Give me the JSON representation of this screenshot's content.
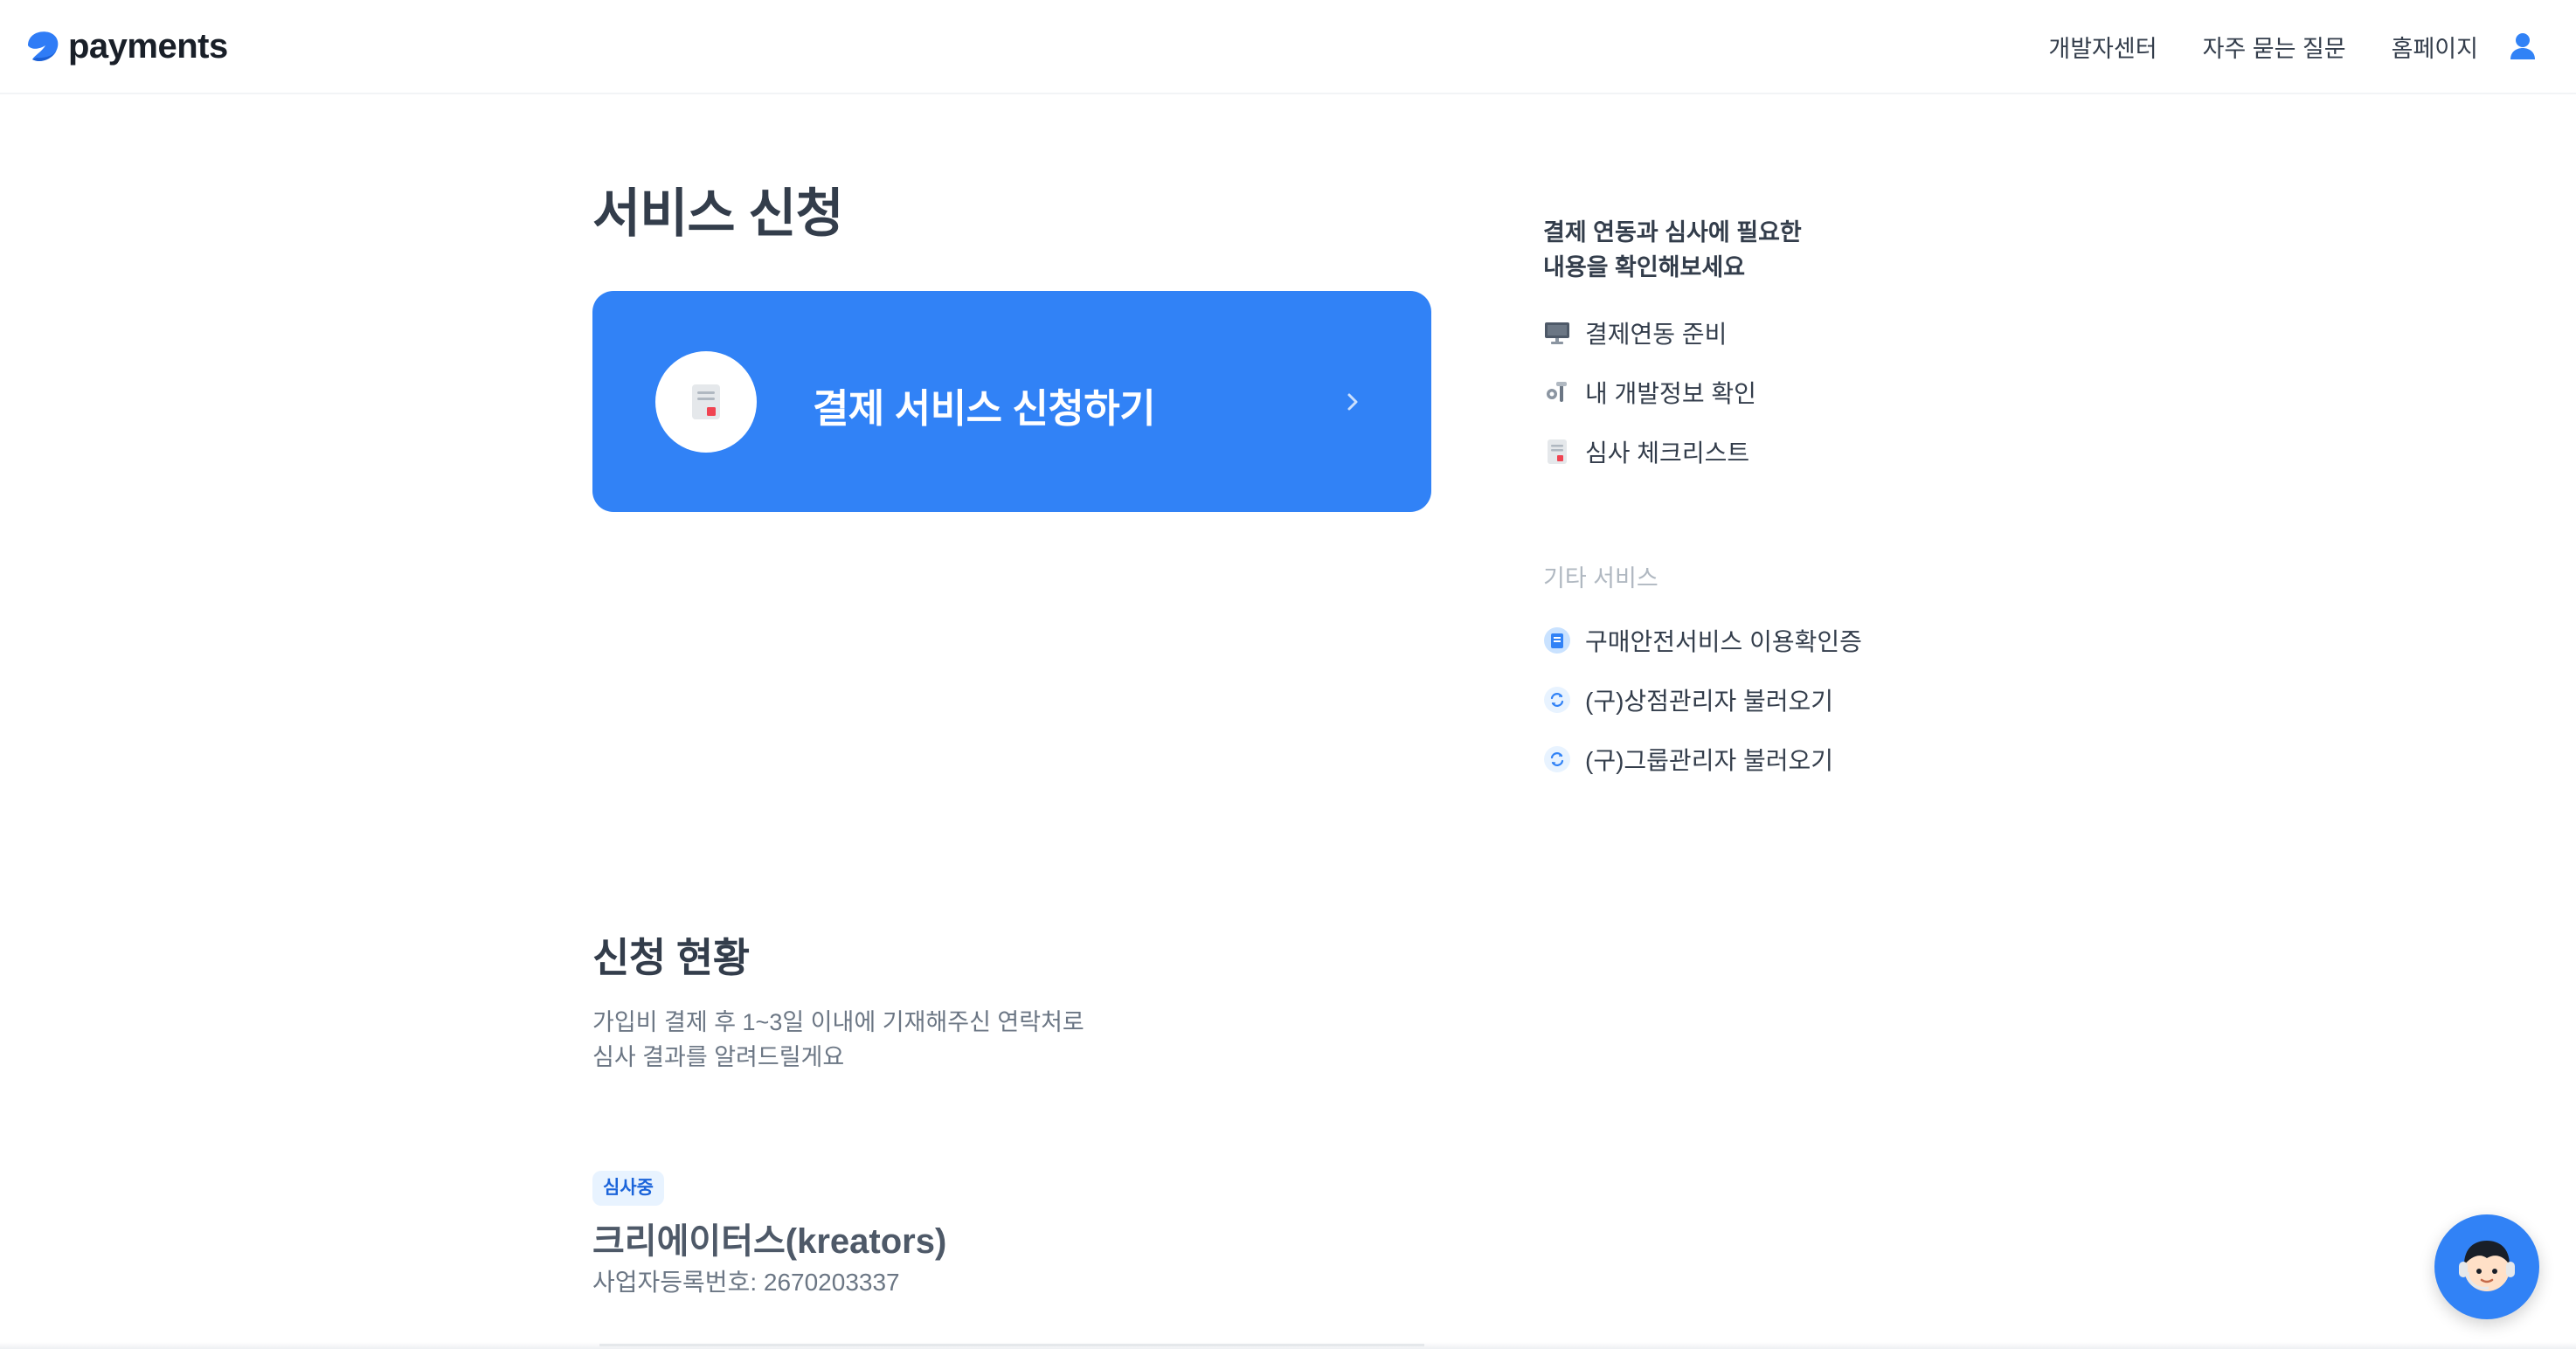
{
  "header": {
    "logo_text": "payments",
    "nav": [
      "개발자센터",
      "자주 묻는 질문",
      "홈페이지"
    ]
  },
  "main": {
    "title": "서비스 신청",
    "apply_card": {
      "label": "결제 서비스 신청하기",
      "color": "#3182f6"
    }
  },
  "sidebar": {
    "guide_title_lines": [
      "결제 연동과 심사에 필요한",
      "내용을 확인해보세요"
    ],
    "guide_items": [
      {
        "label": "결제연동 준비",
        "icon": "monitor-icon"
      },
      {
        "label": "내 개발정보 확인",
        "icon": "tools-icon"
      },
      {
        "label": "심사 체크리스트",
        "icon": "checklist-icon"
      }
    ],
    "other_title": "기타 서비스",
    "other_items": [
      {
        "label": "구매안전서비스 이용확인증",
        "icon": "certificate-icon"
      },
      {
        "label": "(구)상점관리자 불러오기",
        "icon": "refresh-icon"
      },
      {
        "label": "(구)그룹관리자 불러오기",
        "icon": "refresh-icon"
      }
    ]
  },
  "status": {
    "title": "신청 현황",
    "desc_lines": [
      "가입비 결제 후 1~3일 이내에 기재해주신 연락처로",
      "심사 결과를 알려드릴게요"
    ],
    "badge": "심사중",
    "company": "크리에이터스(kreators)",
    "biz_number": "사업자등록번호: 2670203337"
  },
  "colors": {
    "primary": "#3182f6",
    "text": "#333d4b",
    "muted": "#6b7684",
    "badge_bg": "#e8f3ff"
  }
}
